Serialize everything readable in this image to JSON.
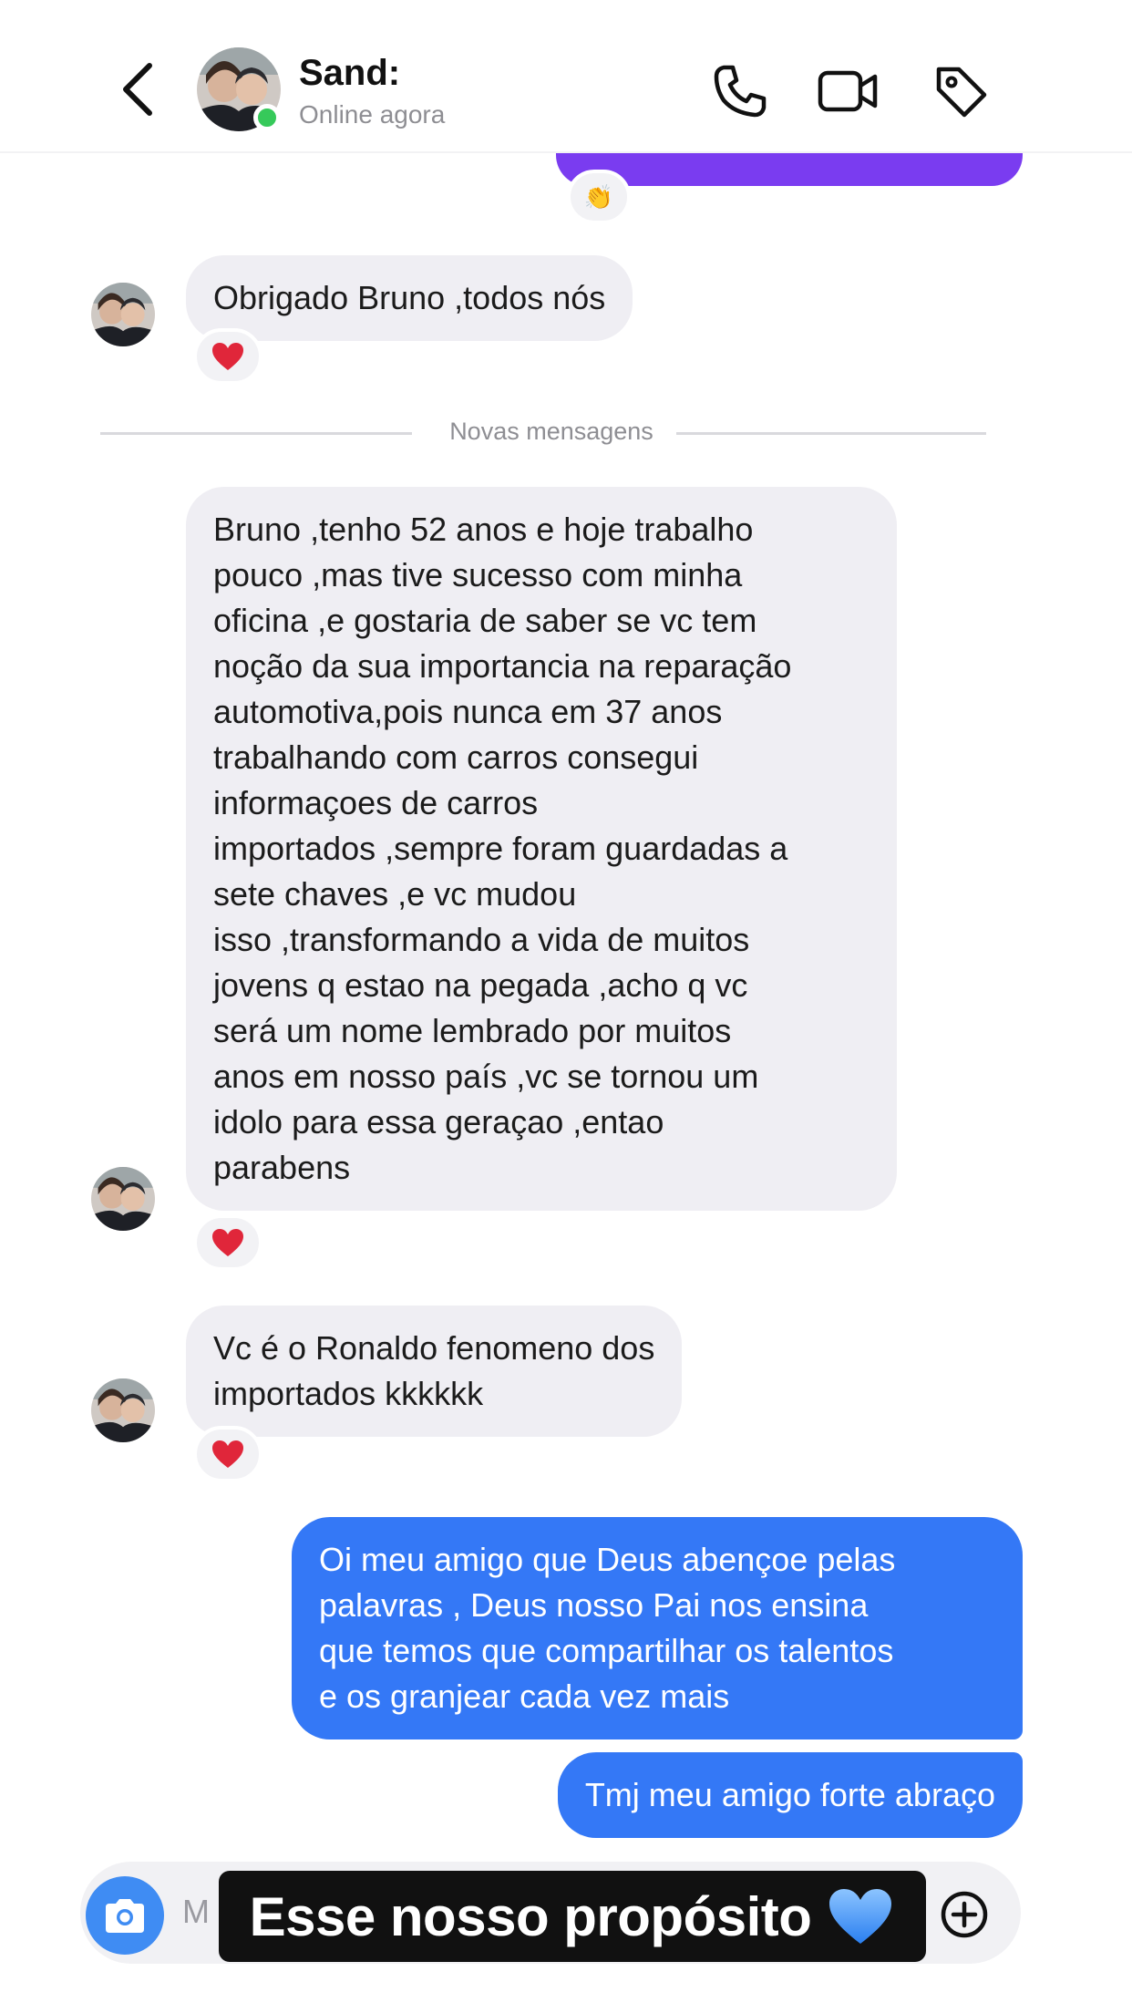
{
  "header": {
    "contact_name": "Sand:",
    "status": "Online agora",
    "icons": [
      "chevron-left-icon",
      "phone-icon",
      "video-camera-icon",
      "tag-icon"
    ]
  },
  "reactions": {
    "small_emoji": "👏",
    "heart": "heart-icon"
  },
  "divider": {
    "label": "Novas mensagens"
  },
  "messages": [
    {
      "from": "contact",
      "text": "Obrigado Bruno ,todos nós",
      "reaction": "heart"
    },
    {
      "from": "contact",
      "lines": [
        "Bruno ,tenho 52 anos e hoje trabalho",
        "pouco ,mas tive sucesso com minha",
        "oficina ,e gostaria de saber se vc tem",
        "noção da sua importancia na reparação",
        "automotiva,pois nunca em 37 anos",
        "trabalhando com carros consegui",
        "informaçoes de carros",
        "importados ,sempre foram guardadas a",
        "sete chaves ,e vc mudou",
        "isso ,transformando a vida de muitos",
        "jovens q estao na pegada ,acho q vc",
        "será um nome lembrado por muitos",
        "anos em nosso país ,vc se tornou um",
        "idolo para essa geraçao ,entao",
        "parabens"
      ],
      "reaction": "heart"
    },
    {
      "from": "contact",
      "lines": [
        "Vc é o Ronaldo fenomeno dos",
        "importados kkkkkk"
      ],
      "reaction": "heart"
    },
    {
      "from": "me",
      "lines": [
        "Oi meu amigo que Deus abençoe pelas",
        "palavras , Deus nosso Pai nos ensina",
        "que temos que compartilhar os talentos",
        "e os granjear cada vez mais"
      ]
    },
    {
      "from": "me",
      "text": "Tmj meu amigo forte abraço"
    }
  ],
  "composer": {
    "placeholder": "M",
    "icons": [
      "camera-icon",
      "plus-circle-icon"
    ]
  },
  "overlay": {
    "caption": "Esse nosso propósito",
    "emoji": "blue-heart-icon"
  },
  "colors": {
    "incoming_bubble": "#efeef3",
    "outgoing_bubble": "#3478f6",
    "purple_bubble": "#7a3cf0",
    "online_dot": "#36c95a",
    "heart": "#e0263a",
    "blue_heart": "#3a8df5"
  }
}
